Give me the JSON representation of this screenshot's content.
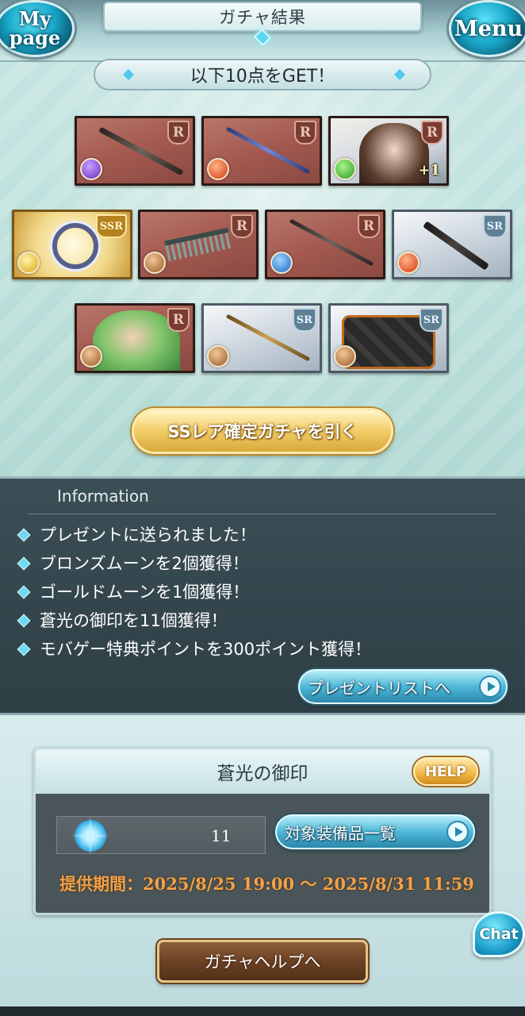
{
  "header": {
    "title": "ガチャ結果",
    "mypage_label": "My page",
    "menu_label": "Menu"
  },
  "result_banner": "以下10点をGET！",
  "items": [
    {
      "rarity": "R",
      "type": "weapon",
      "element": "dark",
      "extra": ""
    },
    {
      "rarity": "R",
      "type": "weapon",
      "element": "fire",
      "extra": ""
    },
    {
      "rarity": "R",
      "type": "character",
      "element": "wind",
      "extra": "+1"
    },
    {
      "rarity": "SSR",
      "type": "summon",
      "element": "light",
      "extra": ""
    },
    {
      "rarity": "R",
      "type": "weapon",
      "element": "earth",
      "extra": ""
    },
    {
      "rarity": "R",
      "type": "weapon",
      "element": "water",
      "extra": ""
    },
    {
      "rarity": "SR",
      "type": "weapon",
      "element": "fire",
      "extra": ""
    },
    {
      "rarity": "R",
      "type": "character",
      "element": "earth",
      "extra": ""
    },
    {
      "rarity": "SR",
      "type": "weapon",
      "element": "earth",
      "extra": ""
    },
    {
      "rarity": "SR",
      "type": "weapon",
      "element": "earth",
      "extra": ""
    }
  ],
  "ssr_button": "SSレア確定ガチャを引く",
  "information": {
    "title": "Information",
    "items": [
      "プレゼントに送られました！",
      "ブロンズムーンを2個獲得！",
      "ゴールドムーンを1個獲得！",
      "蒼光の御印を11個獲得！",
      "モバゲー特典ポイントを300ポイント獲得！"
    ],
    "present_button": "プレゼントリストへ"
  },
  "seal": {
    "title": "蒼光の御印",
    "help_label": "HELP",
    "count": "11",
    "equip_button": "対象装備品一覧",
    "period": "提供期間：2025/8/25 19:00 〜 2025/8/31 11:59"
  },
  "chat_label": "Chat",
  "gacha_help_button": "ガチャヘルプへ",
  "colors": {
    "accent_cyan": "#4fb8d8",
    "gold": "#f0b647",
    "period_orange": "#f2a24a"
  }
}
